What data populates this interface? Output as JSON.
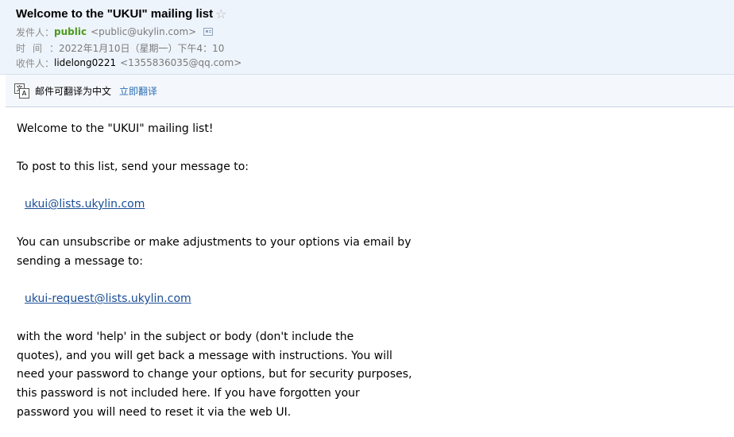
{
  "header": {
    "subject": "Welcome to the \"UKUI\" mailing list",
    "star_icon": "☆",
    "from": {
      "label": "发件人：",
      "name": "public",
      "address": "<public@ukylin.com>",
      "card_icon": "contact-card-icon"
    },
    "time": {
      "label_chars": "时间",
      "colon": "：",
      "value": "2022年1月10日（星期一）下午4：10"
    },
    "to": {
      "label": "收件人：",
      "name": "lidelong0221",
      "address": "<1355836035@qq.com>"
    }
  },
  "translate_bar": {
    "icon": "translate-icon",
    "icon_glyph_a": "文",
    "icon_glyph_b": "A",
    "text": "邮件可翻译为中文",
    "link": "立即翻译"
  },
  "body": {
    "line1": "Welcome to the \"UKUI\" mailing list!",
    "line2": "To post to this list, send your message to:",
    "post_email": "ukui@lists.ukylin.com",
    "line3a": "You can unsubscribe or make adjustments to your options via email by",
    "line3b": "sending a message to:",
    "request_email": "ukui-request@lists.ukylin.com",
    "line4a": "with the word 'help' in the subject or body (don't include the",
    "line4b": "quotes), and you will get back a message with instructions.  You will",
    "line4c": "need your password to change your options, but for security purposes,",
    "line4d": "this password is not included here.  If you have forgotten your",
    "line4e": "password you will need to reset it via the web UI."
  },
  "colors": {
    "header_bg": "#eef4fb",
    "sender_green": "#4a9b1d",
    "link_blue": "#1a4e96",
    "translate_link": "#2c6fb5"
  }
}
